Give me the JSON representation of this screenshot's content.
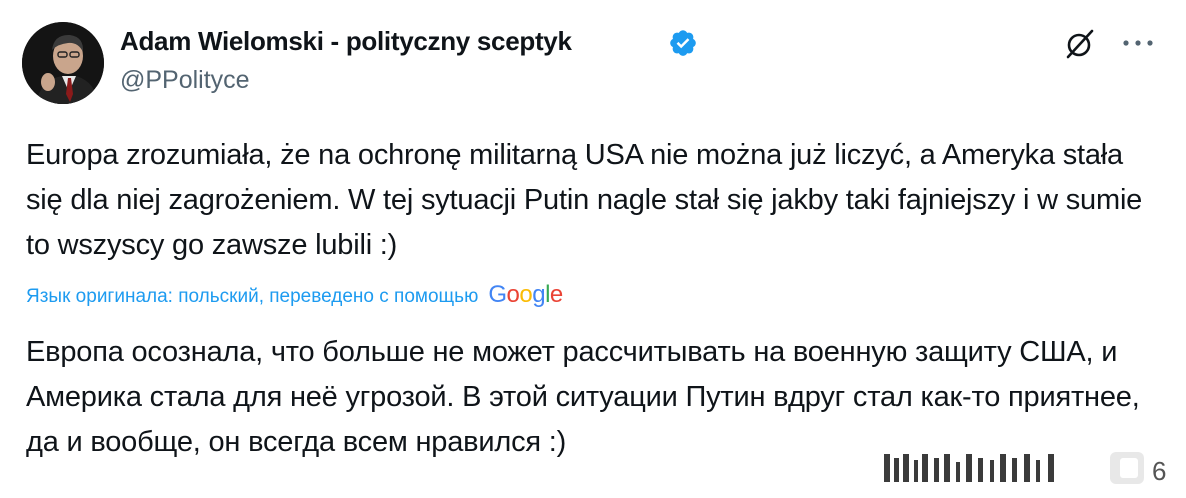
{
  "author": {
    "name": "Adam Wielomski - polityczny sceptyk",
    "handle": "@PPolityce",
    "verified": true
  },
  "tweet": {
    "original_text": "Europa zrozumiała, że na ochronę militarną USA nie można już liczyć, a Ameryka stała się dla niej zagrożeniem. W tej sytuacji Putin nagle stał się jakby taki fajniejszy i w sumie to wszyscy go zawsze lubili :)",
    "translation_label": "Язык оригинала: польский, переведено с помощью",
    "translation_provider": "Google",
    "translated_text": "Европа осознала, что больше не может рассчитывать на военную защиту США, и Америка стала для неё угрозой. В этой ситуации Путин вдруг стал как-то приятнее, да и вообще, он всегда всем нравился :)"
  },
  "icons": {
    "verified": "verified-badge-icon",
    "grok": "grok-icon",
    "more": "more-options-icon"
  },
  "colors": {
    "text": "#0f1419",
    "secondary": "#536471",
    "link": "#1d9bf0",
    "verified": "#1d9bf0"
  }
}
